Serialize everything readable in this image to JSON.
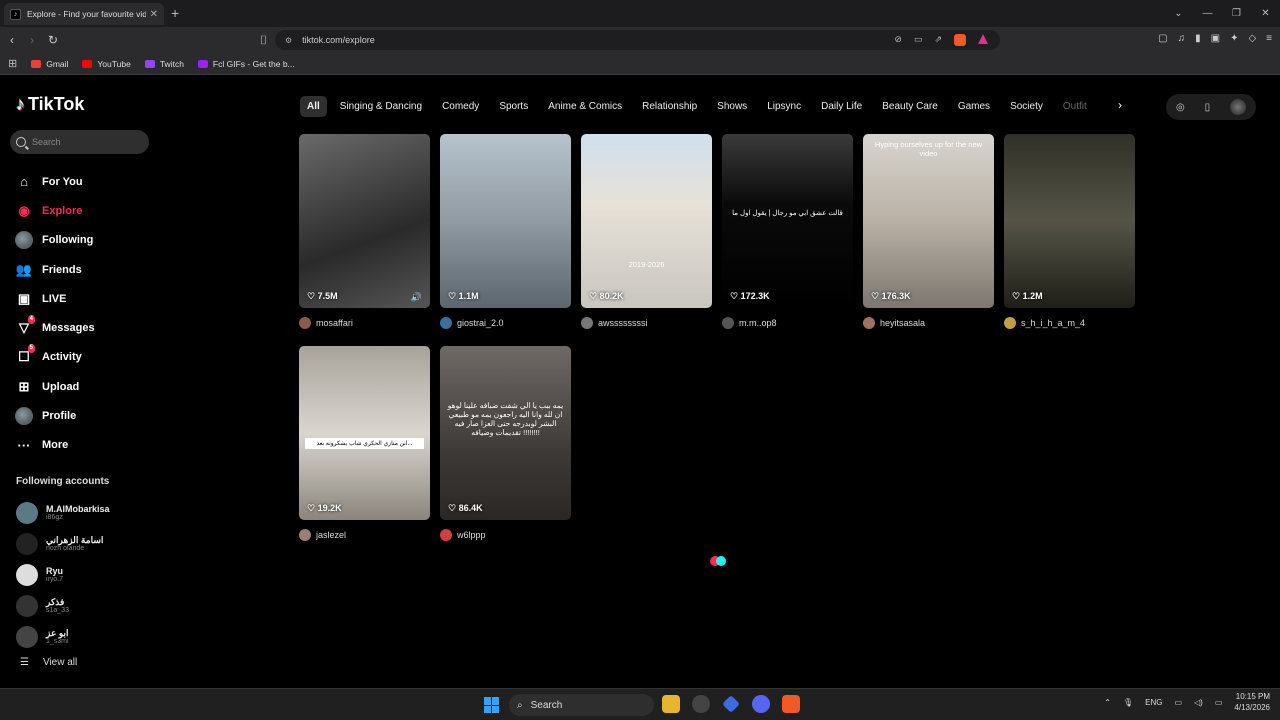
{
  "browser": {
    "tab_title": "Explore - Find your favourite vide",
    "tab_close": "✕",
    "new_tab": "+",
    "url": "tiktok.com/explore",
    "bookmarks": [
      {
        "label": "Gmail",
        "color": "#ea4335"
      },
      {
        "label": "YouTube",
        "color": "#ff0000"
      },
      {
        "label": "Twitch",
        "color": "#9146ff"
      },
      {
        "label": "Fcl GIFs - Get the b...",
        "color": "#a020f0"
      }
    ],
    "window_controls": [
      "⌄",
      "—",
      "❐",
      "✕"
    ]
  },
  "tiktok": {
    "logo": "TikTok",
    "search_placeholder": "Search",
    "nav": [
      {
        "label": "For You",
        "icon": "home-icon",
        "glyph": "⌂"
      },
      {
        "label": "Explore",
        "icon": "compass-icon",
        "glyph": "◉",
        "active": true
      },
      {
        "label": "Following",
        "icon": "following-avatar-icon",
        "glyph": ""
      },
      {
        "label": "Friends",
        "icon": "friends-icon",
        "glyph": "👥"
      },
      {
        "label": "LIVE",
        "icon": "live-icon",
        "glyph": "▣"
      },
      {
        "label": "Messages",
        "icon": "messages-icon",
        "glyph": "▽",
        "badge": "4"
      },
      {
        "label": "Activity",
        "icon": "activity-icon",
        "glyph": "☐",
        "badge": "5"
      },
      {
        "label": "Upload",
        "icon": "upload-icon",
        "glyph": "⊞"
      },
      {
        "label": "Profile",
        "icon": "profile-avatar-icon",
        "glyph": ""
      },
      {
        "label": "More",
        "icon": "more-icon",
        "glyph": "···"
      }
    ],
    "following_title": "Following accounts",
    "following": [
      {
        "name": "M.AlMobarkisa",
        "handle": "i86gz"
      },
      {
        "name": "اسامة الزهراني",
        "handle": "nozh olande"
      },
      {
        "name": "Ryu",
        "handle": "iryo.7"
      },
      {
        "name": "فذكر",
        "handle": "s1a_33"
      },
      {
        "name": "ابو عز",
        "handle": "1_s3mi"
      }
    ],
    "view_all": "View all",
    "categories": [
      "All",
      "Singing & Dancing",
      "Comedy",
      "Sports",
      "Anime & Comics",
      "Relationship",
      "Shows",
      "Lipsync",
      "Daily Life",
      "Beauty Care",
      "Games",
      "Society",
      "Outfit"
    ],
    "videos": [
      {
        "views": "7.5M",
        "author": "mosaffari",
        "bg": "linear-gradient(160deg,#6a6a6a,#2a2a2a 60%,#555)",
        "overlay": ""
      },
      {
        "views": "1.1M",
        "author": "giostrai_2.0",
        "bg": "linear-gradient(180deg,#b7c3cc,#8f9aa3 50%,#5d666d)",
        "overlay": ""
      },
      {
        "views": "80.2K",
        "author": "awssssssssi",
        "bg": "linear-gradient(180deg,#cfe0ee,#e7e1d8 40%,#c9c6c0)",
        "overlay": "2019-2026"
      },
      {
        "views": "172.3K",
        "author": "m.m..op8",
        "bg": "linear-gradient(180deg,#3b3b3b,#0a0a0a 40%,#000)",
        "overlay": "قالت عشق ابي مو رجال | يقول اول ما"
      },
      {
        "views": "176.3K",
        "author": "heyitsasala",
        "bg": "linear-gradient(180deg,#d7d4cf,#b9b1a6 50%,#7c7770)",
        "overlay": "Hyping ourselves up for the new video"
      },
      {
        "views": "1.2M",
        "author": "s_h_i_h_a_m_4",
        "bg": "linear-gradient(180deg,#2f3027,#555447 50%,#1f1f18)",
        "overlay": ""
      },
      {
        "views": "19.2K",
        "author": "jaslezel",
        "bg": "linear-gradient(180deg,#a8a39a,#d9d5cf 50%,#8b857c)",
        "overlay": "ابن منازي الحكري شاب يشكرونه بعد..."
      },
      {
        "views": "86.4K",
        "author": "w6lppp",
        "bg": "linear-gradient(180deg,#6f6a66,#3e3a37 60%,#2a2725)",
        "overlay": "يمه ببب يا الي شفت ضبافه علينا لوهو ان لله وانا اليه راجعون يمه مو طبيعي البشر لوبدرجه حتى العزا صار فيه تقديمات وضيافه !!!!!!!!"
      }
    ]
  },
  "taskbar": {
    "search": "Search",
    "lang": "ENG",
    "time": "10:15 PM",
    "date": "4/13/2026"
  }
}
